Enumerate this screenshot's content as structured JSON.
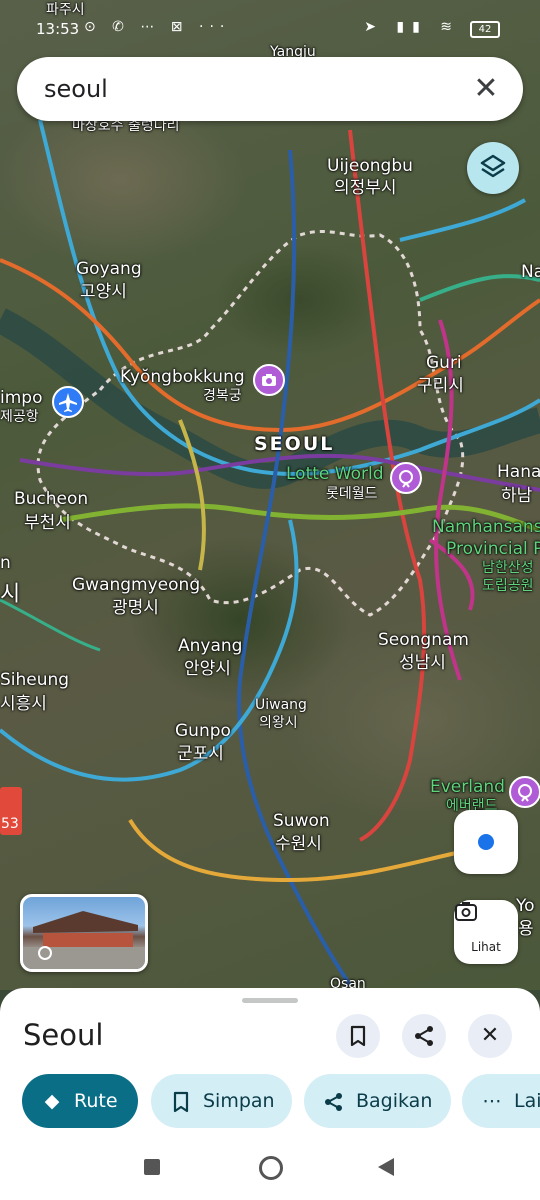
{
  "status_bar": {
    "time": "13:53",
    "icons": "⊙ ✆ ⋯ ⊠ ···",
    "right_icons": "➤ ▮▮ ≋",
    "battery": "42"
  },
  "search": {
    "query": "seoul",
    "clear_icon": "close-icon"
  },
  "map": {
    "labels": [
      {
        "id": "paju",
        "text": "파주시"
      },
      {
        "id": "yangju",
        "text": "Yangju"
      },
      {
        "id": "reservoir",
        "text": "마장호수 출렁다리"
      },
      {
        "id": "uijeongbu",
        "text": "Uijeongbu"
      },
      {
        "id": "uijeongbu_ko",
        "text": "의정부시"
      },
      {
        "id": "goyang",
        "text": "Goyang"
      },
      {
        "id": "goyang_ko",
        "text": "고양시"
      },
      {
        "id": "na",
        "text": "Na"
      },
      {
        "id": "kyongbokkung",
        "text": "Kyŏngbokkung"
      },
      {
        "id": "kyongbokkung_ko",
        "text": "경복궁"
      },
      {
        "id": "guri",
        "text": "Guri"
      },
      {
        "id": "guri_ko",
        "text": "구리시"
      },
      {
        "id": "gimpo",
        "text": "impo"
      },
      {
        "id": "gimpo_ko",
        "text": "제공항"
      },
      {
        "id": "seoul",
        "text": "SEOUL"
      },
      {
        "id": "lotteworld",
        "text": "Lotte World"
      },
      {
        "id": "lotteworld_ko",
        "text": "롯데월드"
      },
      {
        "id": "hanam",
        "text": "Hana"
      },
      {
        "id": "hanam_ko",
        "text": "하남"
      },
      {
        "id": "bucheon",
        "text": "Bucheon"
      },
      {
        "id": "bucheon_ko",
        "text": "부천시"
      },
      {
        "id": "namhansan",
        "text": "Namhansans"
      },
      {
        "id": "namhansan2",
        "text": "Provincial P"
      },
      {
        "id": "namhansan_ko",
        "text": "남한산성"
      },
      {
        "id": "namhansan_ko2",
        "text": "도립공원"
      },
      {
        "id": "gwangmyeong",
        "text": "Gwangmyeong"
      },
      {
        "id": "gwangmyeong_ko",
        "text": "광명시"
      },
      {
        "id": "anyang",
        "text": "Anyang"
      },
      {
        "id": "anyang_ko",
        "text": "안양시"
      },
      {
        "id": "seongnam",
        "text": "Seongnam"
      },
      {
        "id": "seongnam_ko",
        "text": "성남시"
      },
      {
        "id": "siheung",
        "text": "Siheung"
      },
      {
        "id": "siheung_ko",
        "text": "시흥시"
      },
      {
        "id": "uiwang",
        "text": "Uiwang"
      },
      {
        "id": "uiwang_ko",
        "text": "의왕시"
      },
      {
        "id": "gunpo",
        "text": "Gunpo"
      },
      {
        "id": "gunpo_ko",
        "text": "군포시"
      },
      {
        "id": "everland",
        "text": "Everland"
      },
      {
        "id": "everland_ko",
        "text": "에버랜드"
      },
      {
        "id": "suwon",
        "text": "Suwon"
      },
      {
        "id": "suwon_ko",
        "text": "수원시"
      },
      {
        "id": "yo",
        "text": "Yo"
      },
      {
        "id": "yo_ko",
        "text": "용"
      },
      {
        "id": "n_left",
        "text": "n"
      },
      {
        "id": "si_left",
        "text": "시"
      },
      {
        "id": "route53",
        "text": "53"
      },
      {
        "id": "osan",
        "text": "Osan"
      }
    ]
  },
  "controls": {
    "lens_label": "Lihat"
  },
  "sheet": {
    "title": "Seoul",
    "chips": [
      {
        "label": "Rute",
        "icon": "directions-icon"
      },
      {
        "label": "Simpan",
        "icon": "bookmark-icon"
      },
      {
        "label": "Bagikan",
        "icon": "share-icon"
      },
      {
        "label": "Lai",
        "icon": "more-icon"
      }
    ]
  },
  "colors": {
    "primary_chip": "#0b6e87",
    "secondary_chip": "#d3eef5",
    "layers_button": "#b8e6ef",
    "location_dot": "#1a73e8"
  }
}
